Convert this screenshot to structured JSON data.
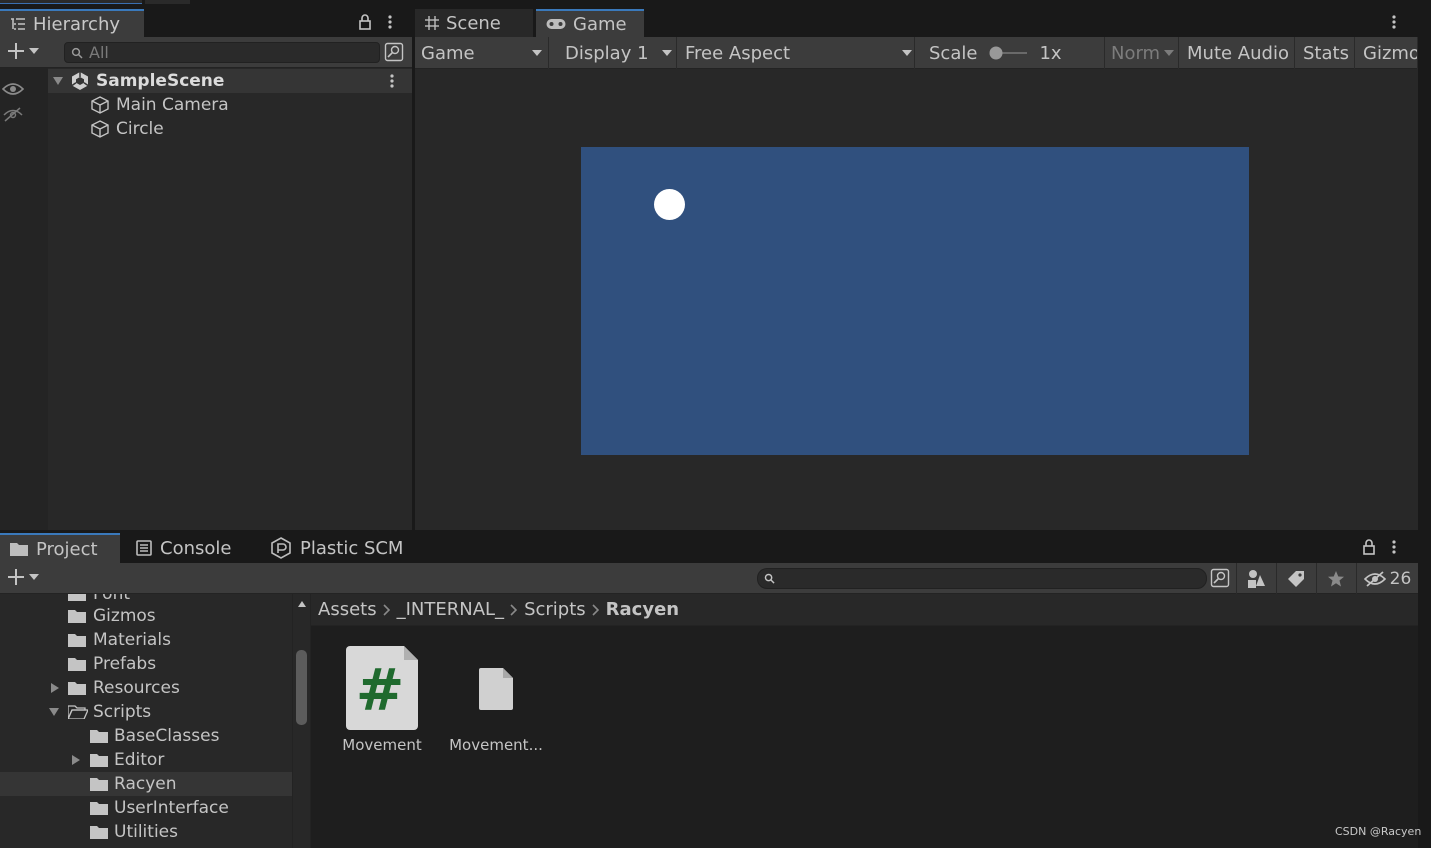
{
  "hierarchy": {
    "tab_label": "Hierarchy",
    "search_placeholder": "All",
    "scene": "SampleScene",
    "objects": [
      "Main Camera",
      "Circle"
    ]
  },
  "game": {
    "tabs": [
      "Scene",
      "Game"
    ],
    "toolbar": {
      "mode": "Game",
      "display": "Display 1",
      "aspect": "Free Aspect",
      "scale_label": "Scale",
      "scale_value": "1x",
      "norm": "Norm",
      "mute": "Mute Audio",
      "stats": "Stats",
      "gizmos": "Gizmos"
    },
    "canvas_color": "#30507e",
    "circle_color": "#ffffff"
  },
  "project": {
    "tabs": [
      "Project",
      "Console",
      "Plastic SCM"
    ],
    "hidden_count": "26",
    "tree": [
      "Font",
      "Gizmos",
      "Materials",
      "Prefabs",
      "Resources",
      "Scripts",
      "BaseClasses",
      "Editor",
      "Racyen",
      "UserInterface",
      "Utilities"
    ],
    "breadcrumb": [
      "Assets",
      "_INTERNAL_",
      "Scripts",
      "Racyen"
    ],
    "assets": [
      "Movement",
      "Movement..."
    ]
  },
  "watermark": "CSDN @Racyen",
  "colors": {
    "accent": "#3a79bb",
    "panel": "#282828",
    "toolbar": "#3c3c3c"
  }
}
